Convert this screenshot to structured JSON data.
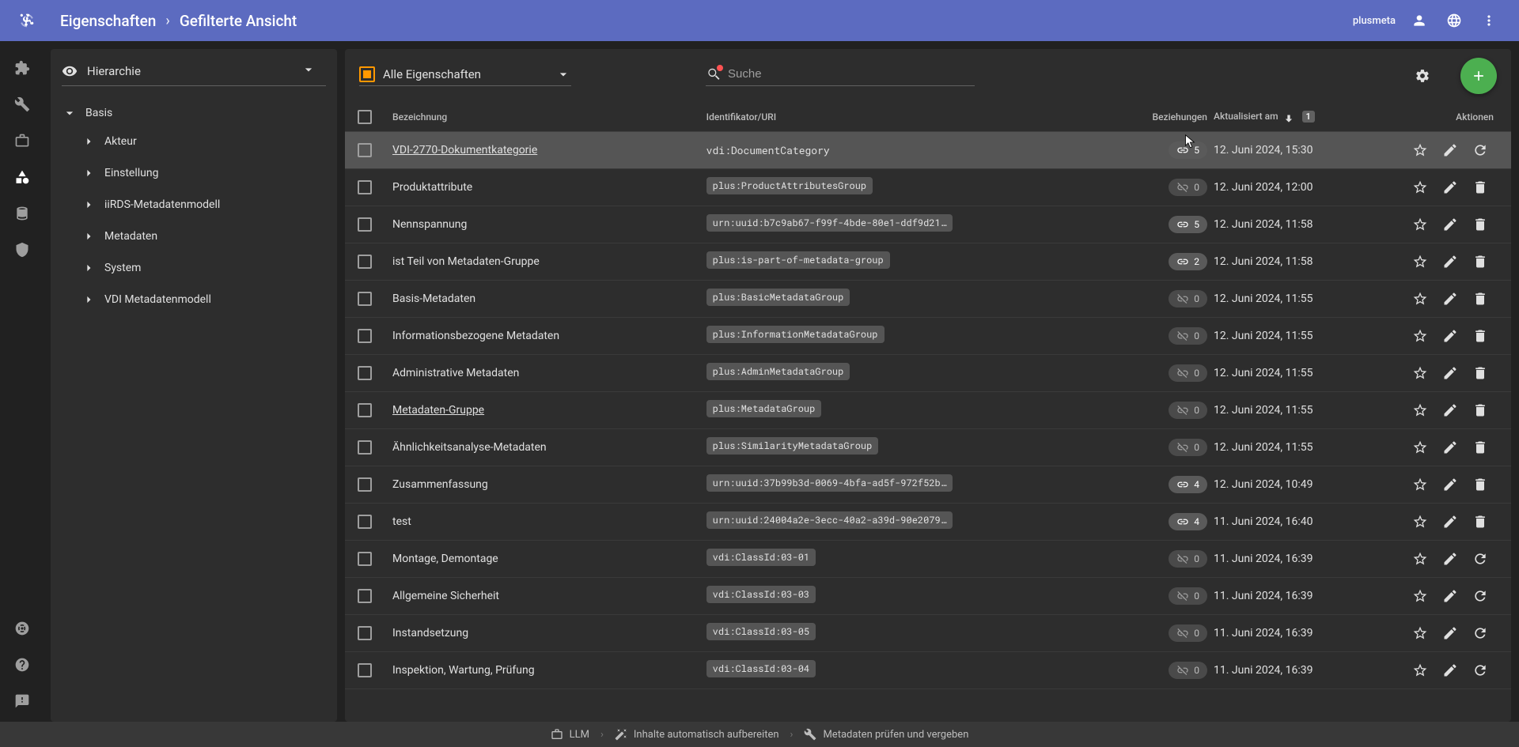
{
  "topbar": {
    "breadcrumb": [
      "Eigenschaften",
      "Gefilterte Ansicht"
    ],
    "user": "plusmeta"
  },
  "sidebar": {
    "view_mode": "Hierarchie",
    "root": "Basis",
    "items": [
      "Akteur",
      "Einstellung",
      "iiRDS-Metadatenmodell",
      "Metadaten",
      "System",
      "VDI Metadatenmodell"
    ]
  },
  "toolbar": {
    "filter_label": "Alle Eigenschaften",
    "search_placeholder": "Suche"
  },
  "columns": {
    "bez": "Bezeichnung",
    "id": "Identifikator/URI",
    "rel": "Beziehungen",
    "upd": "Aktualisiert am",
    "act": "Aktionen",
    "sort_index": "1"
  },
  "rows": [
    {
      "bez": "VDI-2770-Dokumentkategorie",
      "link": true,
      "id": "vdi:DocumentCategory",
      "chip": false,
      "rel": 5,
      "rel_on": true,
      "upd": "12. Juni 2024, 15:30",
      "third": "refresh",
      "hover": true
    },
    {
      "bez": "Produktattribute",
      "link": false,
      "id": "plus:ProductAttributesGroup",
      "chip": true,
      "rel": 0,
      "rel_on": false,
      "upd": "12. Juni 2024, 12:00",
      "third": "delete"
    },
    {
      "bez": "Nennspannung",
      "link": false,
      "id": "urn:uuid:b7c9ab67-f99f-4bde-80e1-ddf9d21…",
      "chip": true,
      "rel": 5,
      "rel_on": true,
      "upd": "12. Juni 2024, 11:58",
      "third": "delete"
    },
    {
      "bez": "ist Teil von Metadaten-Gruppe",
      "link": false,
      "id": "plus:is-part-of-metadata-group",
      "chip": true,
      "rel": 2,
      "rel_on": true,
      "upd": "12. Juni 2024, 11:58",
      "third": "delete"
    },
    {
      "bez": "Basis-Metadaten",
      "link": false,
      "id": "plus:BasicMetadataGroup",
      "chip": true,
      "rel": 0,
      "rel_on": false,
      "upd": "12. Juni 2024, 11:55",
      "third": "delete"
    },
    {
      "bez": "Informationsbezogene Metadaten",
      "link": false,
      "id": "plus:InformationMetadataGroup",
      "chip": true,
      "rel": 0,
      "rel_on": false,
      "upd": "12. Juni 2024, 11:55",
      "third": "delete"
    },
    {
      "bez": "Administrative Metadaten",
      "link": false,
      "id": "plus:AdminMetadataGroup",
      "chip": true,
      "rel": 0,
      "rel_on": false,
      "upd": "12. Juni 2024, 11:55",
      "third": "delete"
    },
    {
      "bez": "Metadaten-Gruppe",
      "link": true,
      "id": "plus:MetadataGroup",
      "chip": true,
      "rel": 0,
      "rel_on": false,
      "upd": "12. Juni 2024, 11:55",
      "third": "delete"
    },
    {
      "bez": "Ähnlichkeitsanalyse-Metadaten",
      "link": false,
      "id": "plus:SimilarityMetadataGroup",
      "chip": true,
      "rel": 0,
      "rel_on": false,
      "upd": "12. Juni 2024, 11:55",
      "third": "delete"
    },
    {
      "bez": "Zusammenfassung",
      "link": false,
      "id": "urn:uuid:37b99b3d-0069-4bfa-ad5f-972f52b…",
      "chip": true,
      "rel": 4,
      "rel_on": true,
      "upd": "12. Juni 2024, 10:49",
      "third": "delete"
    },
    {
      "bez": "test",
      "link": false,
      "id": "urn:uuid:24004a2e-3ecc-40a2-a39d-90e2079…",
      "chip": true,
      "rel": 4,
      "rel_on": true,
      "upd": "11. Juni 2024, 16:40",
      "third": "delete"
    },
    {
      "bez": "Montage, Demontage",
      "link": false,
      "id": "vdi:ClassId:03-01",
      "chip": true,
      "rel": 0,
      "rel_on": false,
      "upd": "11. Juni 2024, 16:39",
      "third": "refresh"
    },
    {
      "bez": "Allgemeine Sicherheit",
      "link": false,
      "id": "vdi:ClassId:03-03",
      "chip": true,
      "rel": 0,
      "rel_on": false,
      "upd": "11. Juni 2024, 16:39",
      "third": "refresh"
    },
    {
      "bez": "Instandsetzung",
      "link": false,
      "id": "vdi:ClassId:03-05",
      "chip": true,
      "rel": 0,
      "rel_on": false,
      "upd": "11. Juni 2024, 16:39",
      "third": "refresh"
    },
    {
      "bez": "Inspektion, Wartung, Prüfung",
      "link": false,
      "id": "vdi:ClassId:03-04",
      "chip": true,
      "rel": 0,
      "rel_on": false,
      "upd": "11. Juni 2024, 16:39",
      "third": "refresh"
    }
  ],
  "footer": {
    "items": [
      "LLM",
      "Inhalte automatisch aufbereiten",
      "Metadaten prüfen und vergeben"
    ]
  }
}
